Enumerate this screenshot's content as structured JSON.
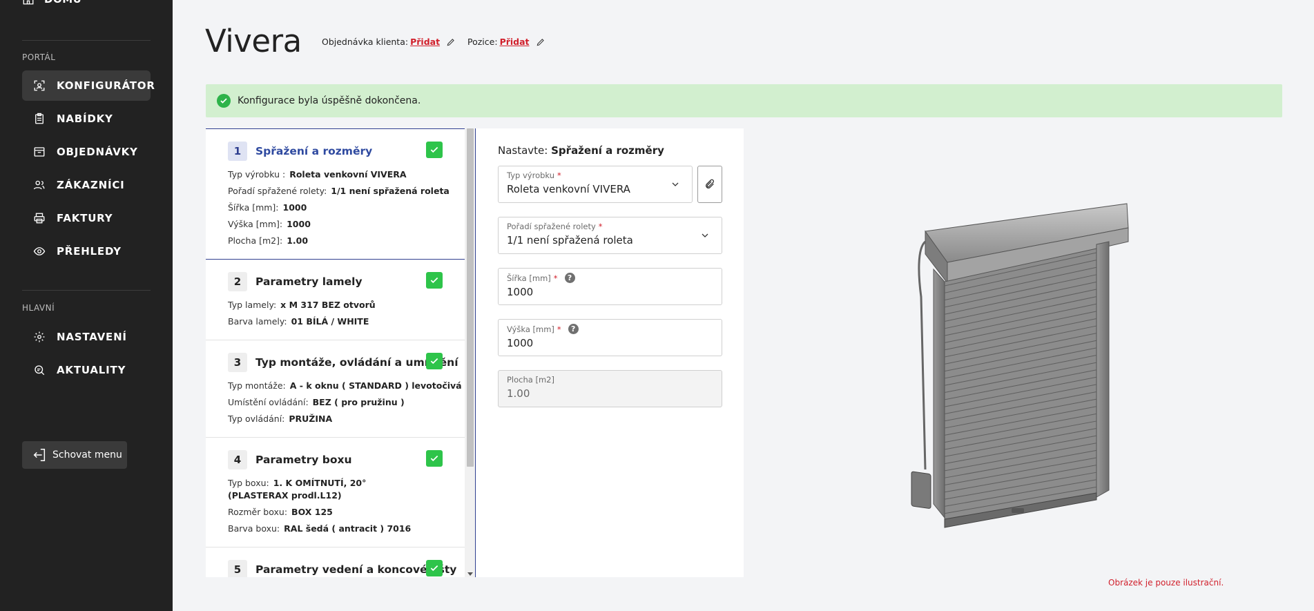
{
  "sidebar": {
    "home_label": "DOMŮ",
    "sections": [
      {
        "label": "PORTÁL"
      },
      {
        "label": "HLAVNÍ"
      }
    ],
    "items": [
      {
        "label": "KONFIGURÁTOR",
        "icon": "scan-icon",
        "active": true
      },
      {
        "label": "NABÍDKY",
        "icon": "clipboard-icon"
      },
      {
        "label": "OBJEDNÁVKY",
        "icon": "box-icon"
      },
      {
        "label": "ZÁKAZNÍCI",
        "icon": "users-icon"
      },
      {
        "label": "FAKTURY",
        "icon": "printer-icon"
      },
      {
        "label": "PŘEHLEDY",
        "icon": "eye-icon"
      },
      {
        "label": "NASTAVENÍ",
        "icon": "gear-icon"
      },
      {
        "label": "AKTUALITY",
        "icon": "news-search-icon"
      }
    ],
    "hide_menu": "Schovat menu"
  },
  "header": {
    "title": "Vivera",
    "client_order_label": "Objednávka klienta:",
    "client_order_link": "Přidat",
    "position_label": "Pozice:",
    "position_link": "Přidat"
  },
  "alert": {
    "text": "Konfigurace byla úspěšně dokončena.",
    "color": "#d2efcf"
  },
  "steps": [
    {
      "num": "1",
      "title": "Spřažení a rozměry",
      "rows": [
        {
          "label": "Typ výrobku :",
          "value": "Roleta venkovní VIVERA"
        },
        {
          "label": "Pořadí spřažené rolety:",
          "value": "1/1 není spřažená roleta"
        },
        {
          "label": "Šířka [mm]:",
          "value": "1000"
        },
        {
          "label": "Výška [mm]:",
          "value": "1000"
        },
        {
          "label": "Plocha [m2]:",
          "value": "1.00"
        }
      ]
    },
    {
      "num": "2",
      "title": "Parametry lamely",
      "rows": [
        {
          "label": "Typ lamely:",
          "value": "x M 317 BEZ otvorů"
        },
        {
          "label": "Barva lamely:",
          "value": "01 BÍLÁ / WHITE"
        }
      ]
    },
    {
      "num": "3",
      "title": "Typ montáže, ovládání a umístění",
      "rows": [
        {
          "label": "Typ montáže:",
          "value": "A - k oknu ( STANDARD ) levotočivá"
        },
        {
          "label": "Umístění ovládání:",
          "value": "BEZ ( pro pružinu )"
        },
        {
          "label": "Typ ovládání:",
          "value": "PRUŽINA"
        }
      ]
    },
    {
      "num": "4",
      "title": "Parametry boxu",
      "rows": [
        {
          "label": "Typ boxu:",
          "value": "1. K OMÍTNUTÍ, 20°(PLASTERAX prodl.L12)"
        },
        {
          "label": "Rozměr boxu:",
          "value": "BOX 125"
        },
        {
          "label": "Barva boxu:",
          "value": "RAL šedá ( antracit ) 7016"
        }
      ]
    },
    {
      "num": "5",
      "title": "Parametry vedení a koncové lišty",
      "rows": []
    }
  ],
  "form": {
    "title_prefix": "Nastavte:",
    "title_section": "Spřažení a rozměry",
    "fields": [
      {
        "label": "Typ výrobku",
        "value": "Roleta venkovní VIVERA",
        "required": "*"
      },
      {
        "label": "Pořadí spřažené rolety",
        "value": "1/1 není spřažená roleta",
        "required": "*"
      },
      {
        "label": "Šířka [mm]",
        "value": "1000",
        "required": "*",
        "help": "?"
      },
      {
        "label": "Výška [mm]",
        "value": "1000",
        "required": "*",
        "help": "?"
      },
      {
        "label": "Plocha [m2]",
        "value": "1.00"
      }
    ]
  },
  "disclaimer": "Obrázek je pouze ilustrační.",
  "colors": {
    "sidebar_bg": "#222222",
    "accent_red": "#d11f2b",
    "check_green": "#2ec44a",
    "active_blue": "#2f4aa0"
  }
}
